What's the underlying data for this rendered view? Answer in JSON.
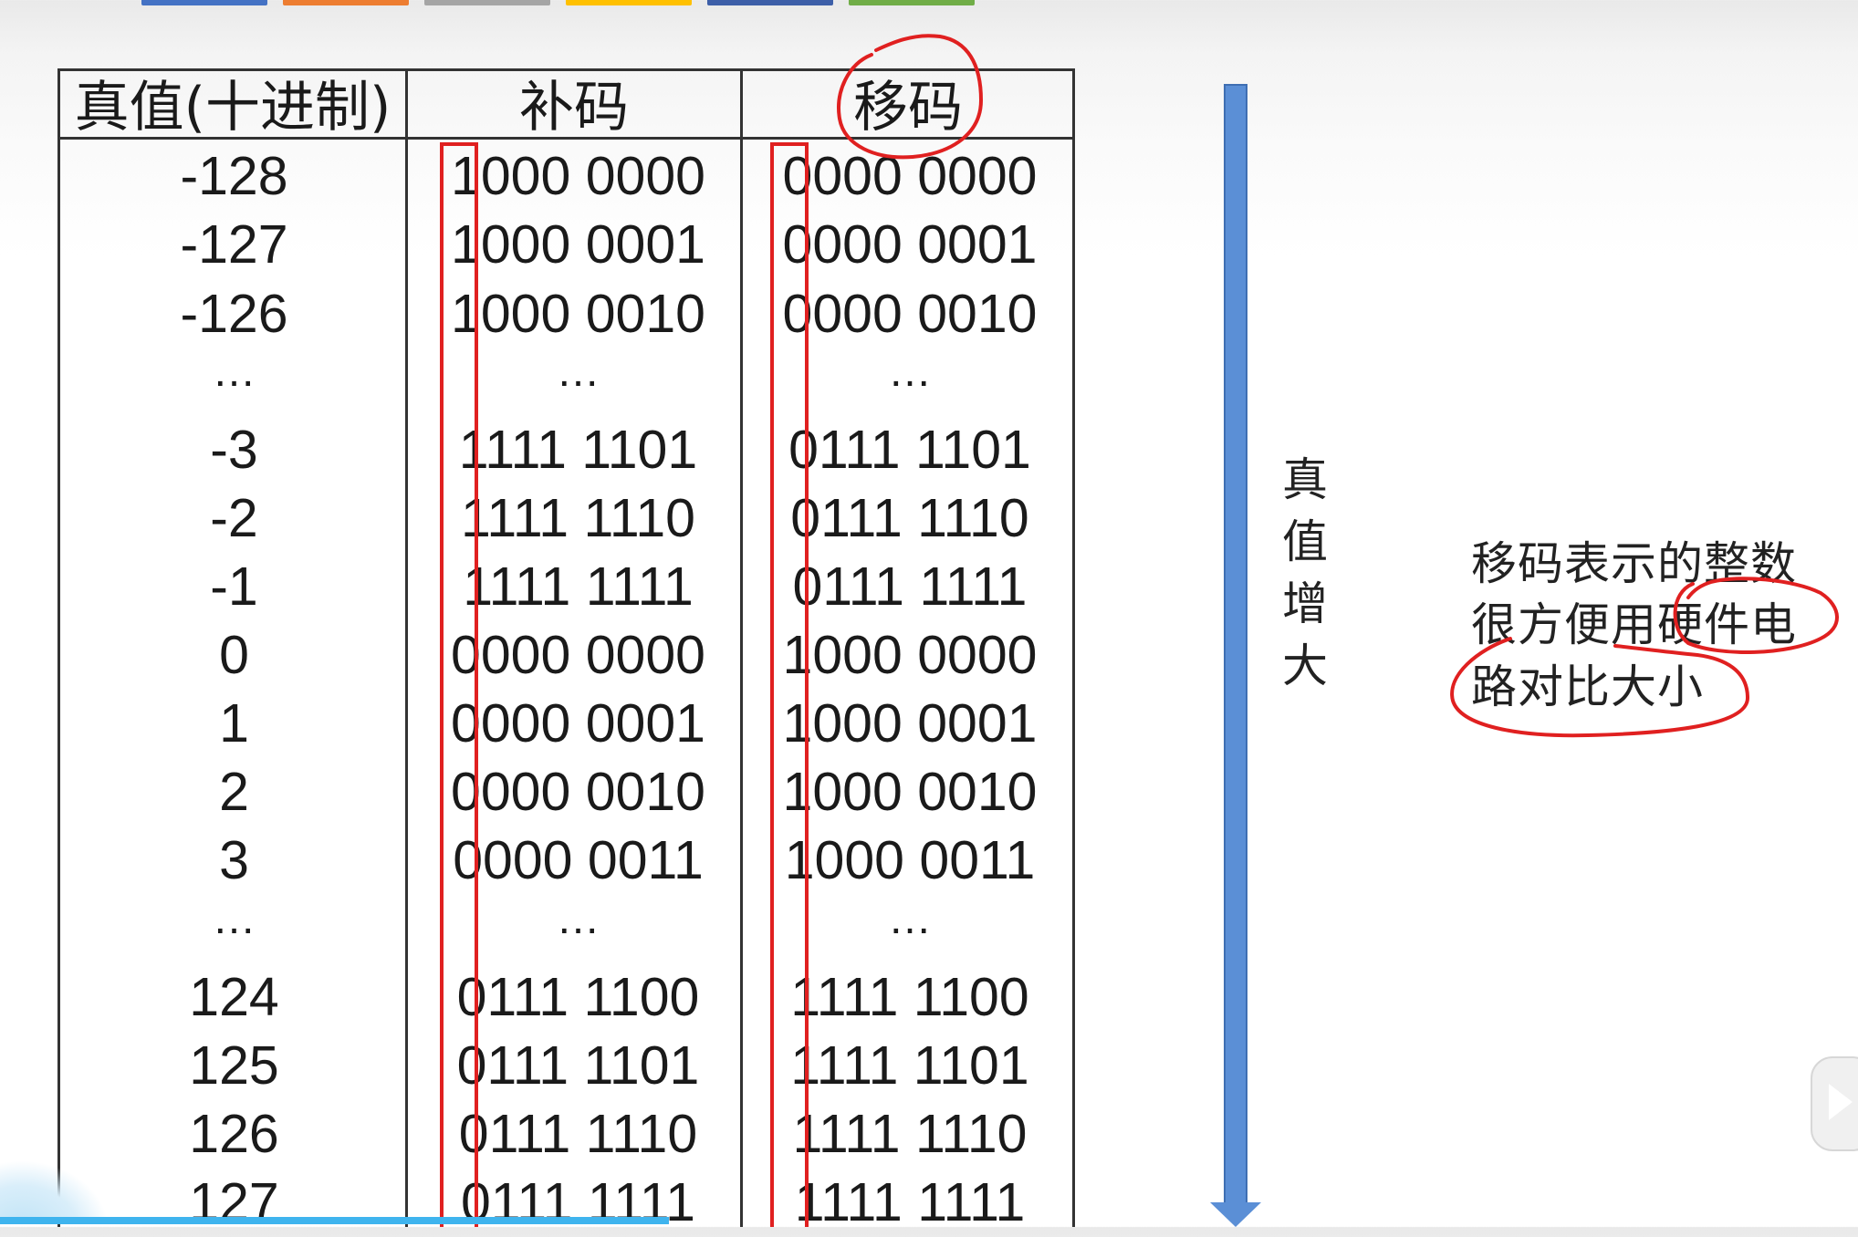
{
  "toolbar": {
    "swatches": [
      {
        "name": "blue",
        "color": "#4472c4"
      },
      {
        "name": "orange",
        "color": "#ed7d31"
      },
      {
        "name": "gray",
        "color": "#a5a5a5"
      },
      {
        "name": "gold",
        "color": "#ffc000"
      },
      {
        "name": "dark-blue",
        "color": "#3d5fa8"
      },
      {
        "name": "green",
        "color": "#70ad47"
      }
    ]
  },
  "table": {
    "headers": [
      "真值(十进制)",
      "补码",
      "移码"
    ],
    "rows": [
      {
        "dec": "-128",
        "comp": "1000 0000",
        "bias": "0000 0000"
      },
      {
        "dec": "-127",
        "comp": "1000 0001",
        "bias": "0000 0001"
      },
      {
        "dec": "-126",
        "comp": "1000 0010",
        "bias": "0000 0010"
      },
      {
        "dec": "…",
        "comp": "…",
        "bias": "…",
        "ellipsis": true
      },
      {
        "dec": "-3",
        "comp": "1111 1101",
        "bias": "0111 1101"
      },
      {
        "dec": "-2",
        "comp": "1111 1110",
        "bias": "0111 1110"
      },
      {
        "dec": "-1",
        "comp": "1111 1111",
        "bias": "0111 1111"
      },
      {
        "dec": "0",
        "comp": "0000 0000",
        "bias": "1000 0000"
      },
      {
        "dec": "1",
        "comp": "0000 0001",
        "bias": "1000 0001"
      },
      {
        "dec": "2",
        "comp": "0000 0010",
        "bias": "1000 0010"
      },
      {
        "dec": "3",
        "comp": "0000 0011",
        "bias": "1000 0011"
      },
      {
        "dec": "…",
        "comp": "…",
        "bias": "…",
        "ellipsis": true
      },
      {
        "dec": "124",
        "comp": "0111 1100",
        "bias": "1111 1100"
      },
      {
        "dec": "125",
        "comp": "0111 1101",
        "bias": "1111 1101"
      },
      {
        "dec": "126",
        "comp": "0111 1110",
        "bias": "1111 1110"
      },
      {
        "dec": "127",
        "comp": "0111 1111",
        "bias": "1111 1111"
      }
    ]
  },
  "arrow": {
    "label_chars": [
      "真",
      "值",
      "增",
      "大"
    ],
    "color": "#5b8fd6"
  },
  "note": {
    "lines": [
      "移码表示的整数",
      "很方便用硬件电",
      "路对比大小"
    ]
  },
  "annotation_color": "#e02020"
}
